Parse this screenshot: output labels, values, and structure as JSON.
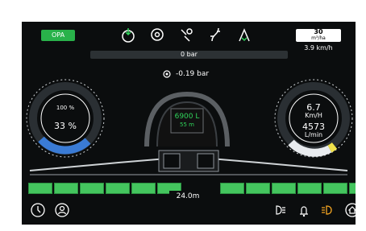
{
  "header": {
    "opa_label": "OPA",
    "pressure_bar_value": "0 bar",
    "speed_box": {
      "set_value": "30",
      "set_unit": "m³/ha",
      "current_speed": "3.9 km/h"
    }
  },
  "icons": {
    "top": [
      "fill-icon",
      "pump-icon",
      "spray-nozzle-icon",
      "section-control-icon",
      "boom-fold-icon"
    ],
    "bottom_left": [
      "settings-dial-icon",
      "operator-icon"
    ],
    "bottom_right": [
      "headlight-icon",
      "bell-icon",
      "work-light-icon",
      "home-icon"
    ]
  },
  "left_gauge": {
    "top_label": "100 %",
    "value_label": "33 %",
    "fill_fraction": 0.33,
    "color": "#3a7bd5"
  },
  "center": {
    "pressure_label": "-0.19 bar",
    "tank_volume": "6900 L",
    "tank_subtext": "55 m"
  },
  "right_gauge": {
    "speed": "6.7",
    "speed_unit": "Km/H",
    "flow": "4573",
    "flow_unit": "L/min",
    "fill_fraction": 0.42,
    "color": "#f0e24b"
  },
  "boom": {
    "sections_on": 12,
    "width_label": "24.0m"
  },
  "colors": {
    "accent_green": "#29b24a",
    "screen_bg": "#0b0d0e",
    "white": "#ffffff"
  }
}
